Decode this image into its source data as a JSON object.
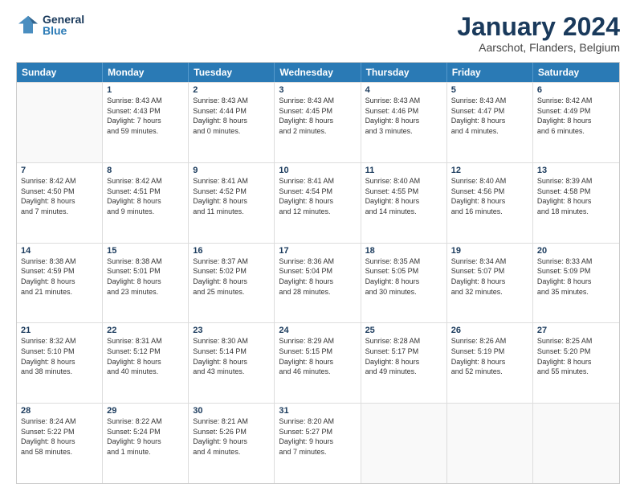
{
  "header": {
    "logo_general": "General",
    "logo_blue": "Blue",
    "title": "January 2024",
    "subtitle": "Aarschot, Flanders, Belgium"
  },
  "days": [
    "Sunday",
    "Monday",
    "Tuesday",
    "Wednesday",
    "Thursday",
    "Friday",
    "Saturday"
  ],
  "weeks": [
    [
      {
        "day": "",
        "info": ""
      },
      {
        "day": "1",
        "info": "Sunrise: 8:43 AM\nSunset: 4:43 PM\nDaylight: 7 hours\nand 59 minutes."
      },
      {
        "day": "2",
        "info": "Sunrise: 8:43 AM\nSunset: 4:44 PM\nDaylight: 8 hours\nand 0 minutes."
      },
      {
        "day": "3",
        "info": "Sunrise: 8:43 AM\nSunset: 4:45 PM\nDaylight: 8 hours\nand 2 minutes."
      },
      {
        "day": "4",
        "info": "Sunrise: 8:43 AM\nSunset: 4:46 PM\nDaylight: 8 hours\nand 3 minutes."
      },
      {
        "day": "5",
        "info": "Sunrise: 8:43 AM\nSunset: 4:47 PM\nDaylight: 8 hours\nand 4 minutes."
      },
      {
        "day": "6",
        "info": "Sunrise: 8:42 AM\nSunset: 4:49 PM\nDaylight: 8 hours\nand 6 minutes."
      }
    ],
    [
      {
        "day": "7",
        "info": "Sunrise: 8:42 AM\nSunset: 4:50 PM\nDaylight: 8 hours\nand 7 minutes."
      },
      {
        "day": "8",
        "info": "Sunrise: 8:42 AM\nSunset: 4:51 PM\nDaylight: 8 hours\nand 9 minutes."
      },
      {
        "day": "9",
        "info": "Sunrise: 8:41 AM\nSunset: 4:52 PM\nDaylight: 8 hours\nand 11 minutes."
      },
      {
        "day": "10",
        "info": "Sunrise: 8:41 AM\nSunset: 4:54 PM\nDaylight: 8 hours\nand 12 minutes."
      },
      {
        "day": "11",
        "info": "Sunrise: 8:40 AM\nSunset: 4:55 PM\nDaylight: 8 hours\nand 14 minutes."
      },
      {
        "day": "12",
        "info": "Sunrise: 8:40 AM\nSunset: 4:56 PM\nDaylight: 8 hours\nand 16 minutes."
      },
      {
        "day": "13",
        "info": "Sunrise: 8:39 AM\nSunset: 4:58 PM\nDaylight: 8 hours\nand 18 minutes."
      }
    ],
    [
      {
        "day": "14",
        "info": "Sunrise: 8:38 AM\nSunset: 4:59 PM\nDaylight: 8 hours\nand 21 minutes."
      },
      {
        "day": "15",
        "info": "Sunrise: 8:38 AM\nSunset: 5:01 PM\nDaylight: 8 hours\nand 23 minutes."
      },
      {
        "day": "16",
        "info": "Sunrise: 8:37 AM\nSunset: 5:02 PM\nDaylight: 8 hours\nand 25 minutes."
      },
      {
        "day": "17",
        "info": "Sunrise: 8:36 AM\nSunset: 5:04 PM\nDaylight: 8 hours\nand 28 minutes."
      },
      {
        "day": "18",
        "info": "Sunrise: 8:35 AM\nSunset: 5:05 PM\nDaylight: 8 hours\nand 30 minutes."
      },
      {
        "day": "19",
        "info": "Sunrise: 8:34 AM\nSunset: 5:07 PM\nDaylight: 8 hours\nand 32 minutes."
      },
      {
        "day": "20",
        "info": "Sunrise: 8:33 AM\nSunset: 5:09 PM\nDaylight: 8 hours\nand 35 minutes."
      }
    ],
    [
      {
        "day": "21",
        "info": "Sunrise: 8:32 AM\nSunset: 5:10 PM\nDaylight: 8 hours\nand 38 minutes."
      },
      {
        "day": "22",
        "info": "Sunrise: 8:31 AM\nSunset: 5:12 PM\nDaylight: 8 hours\nand 40 minutes."
      },
      {
        "day": "23",
        "info": "Sunrise: 8:30 AM\nSunset: 5:14 PM\nDaylight: 8 hours\nand 43 minutes."
      },
      {
        "day": "24",
        "info": "Sunrise: 8:29 AM\nSunset: 5:15 PM\nDaylight: 8 hours\nand 46 minutes."
      },
      {
        "day": "25",
        "info": "Sunrise: 8:28 AM\nSunset: 5:17 PM\nDaylight: 8 hours\nand 49 minutes."
      },
      {
        "day": "26",
        "info": "Sunrise: 8:26 AM\nSunset: 5:19 PM\nDaylight: 8 hours\nand 52 minutes."
      },
      {
        "day": "27",
        "info": "Sunrise: 8:25 AM\nSunset: 5:20 PM\nDaylight: 8 hours\nand 55 minutes."
      }
    ],
    [
      {
        "day": "28",
        "info": "Sunrise: 8:24 AM\nSunset: 5:22 PM\nDaylight: 8 hours\nand 58 minutes."
      },
      {
        "day": "29",
        "info": "Sunrise: 8:22 AM\nSunset: 5:24 PM\nDaylight: 9 hours\nand 1 minute."
      },
      {
        "day": "30",
        "info": "Sunrise: 8:21 AM\nSunset: 5:26 PM\nDaylight: 9 hours\nand 4 minutes."
      },
      {
        "day": "31",
        "info": "Sunrise: 8:20 AM\nSunset: 5:27 PM\nDaylight: 9 hours\nand 7 minutes."
      },
      {
        "day": "",
        "info": ""
      },
      {
        "day": "",
        "info": ""
      },
      {
        "day": "",
        "info": ""
      }
    ]
  ]
}
